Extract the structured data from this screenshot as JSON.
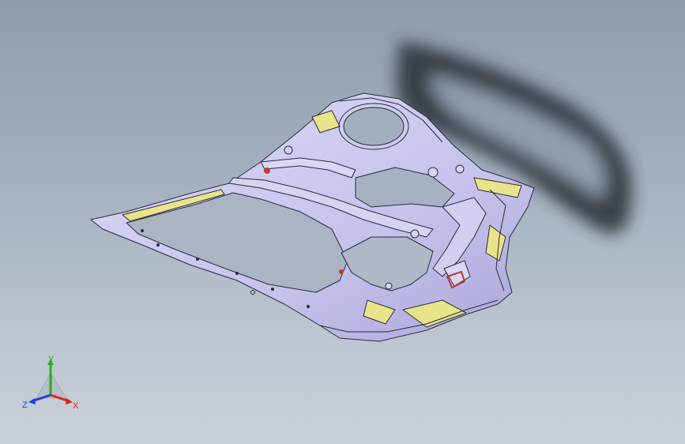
{
  "viewport": {
    "background_top": "#8e9cae",
    "background_bottom": "#c9d0d8"
  },
  "model": {
    "body_color": "#c9c6ee",
    "accent_color": "#e8e48a",
    "edge_color": "#2a2a3a",
    "highlight_color": "#c0392b",
    "shadow_color": "#2b2f36"
  },
  "triad": {
    "x_label": "X",
    "y_label": "Y",
    "z_label": "Z",
    "x_color": "#e02020",
    "y_color": "#20b020",
    "z_color": "#2040e0"
  }
}
